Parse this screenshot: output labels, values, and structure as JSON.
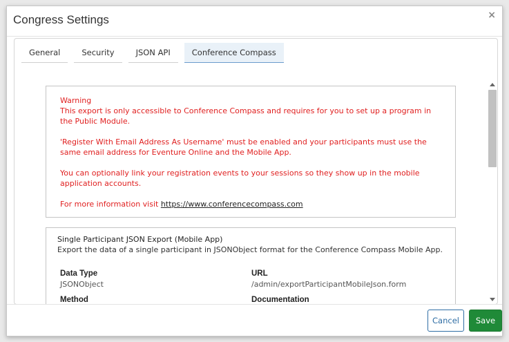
{
  "dialog": {
    "title": "Congress Settings",
    "close_glyph": "×"
  },
  "tabs": [
    {
      "label": "General",
      "active": false
    },
    {
      "label": "Security",
      "active": false
    },
    {
      "label": "JSON API",
      "active": false
    },
    {
      "label": "Conference Compass",
      "active": true
    }
  ],
  "warning": {
    "title": "Warning",
    "para1": "This export is only accessible to Conference Compass and requires for you to set up a program in the Public Module.",
    "para2": "'Register With Email Address As Username' must be enabled and your participants must use the same email address for Eventure Online and the Mobile App.",
    "para3": "You can optionally link your registration events to your sessions so they show up in the mobile application accounts.",
    "para4_prefix": "For more information visit ",
    "link_text": "https://www.conferencecompass.com"
  },
  "export": {
    "title": "Single Participant JSON Export (Mobile App)",
    "description": "Export the data of a single participant in JSONObject format for the Conference Compass Mobile App.",
    "data_type_label": "Data Type",
    "data_type_value": "JSONObject",
    "url_label": "URL",
    "url_value": "/admin/exportParticipantMobileJson.form",
    "method_label": "Method",
    "documentation_label": "Documentation"
  },
  "footer": {
    "cancel_label": "Cancel",
    "save_label": "Save"
  },
  "colors": {
    "warning_text": "#e02020",
    "save_bg": "#1f8a38",
    "cancel_border": "#2e6da4",
    "active_tab_bg": "#e9f1f8"
  },
  "icons": {
    "close": "close-icon",
    "scroll_up": "chevron-up-icon",
    "scroll_down": "chevron-down-icon"
  }
}
